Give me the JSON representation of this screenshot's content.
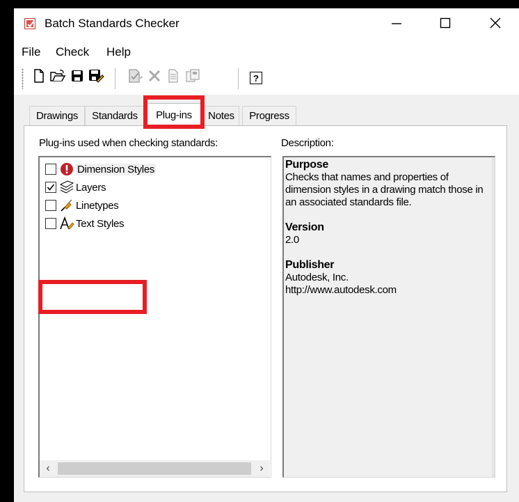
{
  "window": {
    "title": "Batch Standards Checker"
  },
  "menu": [
    "File",
    "Check",
    "Help"
  ],
  "tabs": [
    {
      "label": "Drawings",
      "active": false
    },
    {
      "label": "Standards",
      "active": false
    },
    {
      "label": "Plug-ins",
      "active": true
    },
    {
      "label": "Notes",
      "active": false
    },
    {
      "label": "Progress",
      "active": false
    }
  ],
  "plugins": {
    "caption": "Plug-ins used when checking standards:",
    "items": [
      {
        "label": "Dimension Styles",
        "checked": false,
        "icon": "dimension-styles-icon"
      },
      {
        "label": "Layers",
        "checked": true,
        "icon": "layers-icon"
      },
      {
        "label": "Linetypes",
        "checked": false,
        "icon": "linetypes-icon"
      },
      {
        "label": "Text Styles",
        "checked": false,
        "icon": "text-styles-icon"
      }
    ]
  },
  "description": {
    "caption": "Description:",
    "purpose_heading": "Purpose",
    "purpose_text": "Checks that names and properties of dimension styles in a drawing match those in an associated standards file.",
    "version_heading": "Version",
    "version_text": "2.0",
    "publisher_heading": "Publisher",
    "publisher_name": "Autodesk, Inc.",
    "publisher_url": "http://www.autodesk.com"
  },
  "help_label": "?",
  "colors": {
    "highlight": "#e81e25",
    "accent": "#d9534f"
  }
}
